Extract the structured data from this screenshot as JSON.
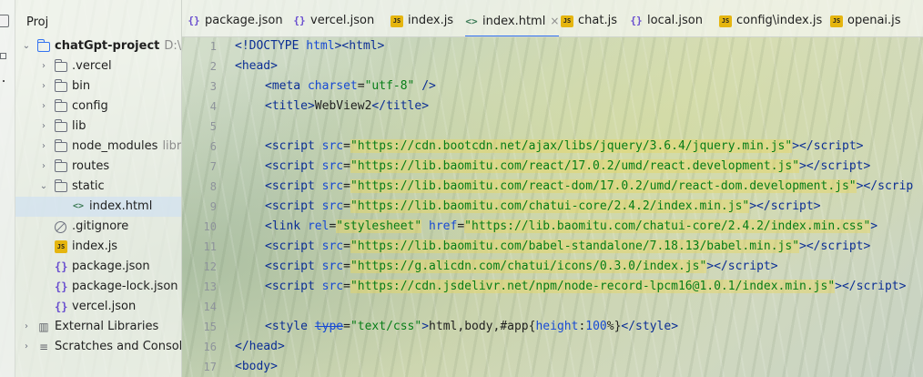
{
  "project_panel": {
    "title": "Proj",
    "tree": [
      {
        "label": "chatGpt-project",
        "hint": "D:\\Pro",
        "type": "module-folder",
        "chevron": "⌄"
      },
      {
        "label": ".vercel",
        "type": "folder",
        "chevron": "›"
      },
      {
        "label": "bin",
        "type": "folder",
        "chevron": "›"
      },
      {
        "label": "config",
        "type": "folder",
        "chevron": "›"
      },
      {
        "label": "lib",
        "type": "folder",
        "chevron": "›"
      },
      {
        "label": "node_modules",
        "hint": "libra",
        "type": "folder",
        "chevron": "›"
      },
      {
        "label": "routes",
        "type": "folder",
        "chevron": "›"
      },
      {
        "label": "static",
        "type": "folder",
        "chevron": "⌄"
      },
      {
        "label": "index.html",
        "type": "html-file",
        "chevron": ""
      },
      {
        "label": ".gitignore",
        "type": "ignore-file",
        "chevron": ""
      },
      {
        "label": "index.js",
        "type": "js-file",
        "chevron": ""
      },
      {
        "label": "package.json",
        "type": "json-file",
        "chevron": ""
      },
      {
        "label": "package-lock.json",
        "type": "json-file",
        "chevron": ""
      },
      {
        "label": "vercel.json",
        "type": "json-file",
        "chevron": ""
      },
      {
        "label": "External Libraries",
        "type": "libraries",
        "chevron": "›"
      },
      {
        "label": "Scratches and Console",
        "type": "scratches",
        "chevron": "›"
      }
    ]
  },
  "tabs": [
    {
      "label": "package.json",
      "icon": "json-icon",
      "glyph": "{}"
    },
    {
      "label": "vercel.json",
      "icon": "json-icon",
      "glyph": "{}"
    },
    {
      "label": "index.js",
      "icon": "js-icon",
      "glyph": "JS"
    },
    {
      "label": "index.html",
      "icon": "html-icon",
      "glyph": "<>",
      "active": true,
      "close": "×"
    },
    {
      "label": "chat.js",
      "icon": "js-icon",
      "glyph": "JS"
    },
    {
      "label": "local.json",
      "icon": "json-icon",
      "glyph": "{}"
    },
    {
      "label": "config\\index.js",
      "icon": "js-icon",
      "glyph": "JS"
    },
    {
      "label": "openai.js",
      "icon": "js-icon",
      "glyph": "JS"
    }
  ],
  "editor": {
    "line_numbers": [
      "1",
      "2",
      "3",
      "4",
      "5",
      "6",
      "7",
      "8",
      "9",
      "10",
      "11",
      "12",
      "13",
      "14",
      "15",
      "16",
      "17"
    ],
    "lines": [
      {
        "indent": 0,
        "tokens": [
          [
            "t",
            "<!DOCTYPE "
          ],
          [
            "a",
            "html"
          ],
          [
            "t",
            ">"
          ],
          [
            "t",
            "<html>"
          ]
        ]
      },
      {
        "indent": 0,
        "tokens": [
          [
            "t",
            "<head>"
          ]
        ]
      },
      {
        "indent": 1,
        "tokens": [
          [
            "t",
            "<meta "
          ],
          [
            "a",
            "charset"
          ],
          [
            "p",
            "="
          ],
          [
            "s",
            "\"utf-8\""
          ],
          [
            "t",
            " />"
          ]
        ]
      },
      {
        "indent": 1,
        "tokens": [
          [
            "t",
            "<title>"
          ],
          [
            "p",
            "WebView2"
          ],
          [
            "t",
            "</title>"
          ]
        ]
      },
      {
        "indent": 0,
        "tokens": []
      },
      {
        "indent": 1,
        "tokens": [
          [
            "t",
            "<script "
          ],
          [
            "a",
            "src"
          ],
          [
            "p",
            "="
          ],
          [
            "sh",
            "\"https://cdn.bootcdn.net/ajax/libs/jquery/3.6.4/jquery.min.js\""
          ],
          [
            "t",
            "></"
          ],
          [
            "t",
            "script"
          ],
          [
            "t",
            ">"
          ]
        ]
      },
      {
        "indent": 1,
        "tokens": [
          [
            "t",
            "<script "
          ],
          [
            "a",
            "src"
          ],
          [
            "p",
            "="
          ],
          [
            "sh",
            "\"https://lib.baomitu.com/react/17.0.2/umd/react.development.js\""
          ],
          [
            "t",
            "></"
          ],
          [
            "t",
            "script"
          ],
          [
            "t",
            ">"
          ]
        ]
      },
      {
        "indent": 1,
        "tokens": [
          [
            "t",
            "<script "
          ],
          [
            "a",
            "src"
          ],
          [
            "p",
            "="
          ],
          [
            "sh",
            "\"https://lib.baomitu.com/react-dom/17.0.2/umd/react-dom.development.js\""
          ],
          [
            "t",
            "></"
          ],
          [
            "t",
            "scrip"
          ]
        ]
      },
      {
        "indent": 1,
        "tokens": [
          [
            "t",
            "<script "
          ],
          [
            "a",
            "src"
          ],
          [
            "p",
            "="
          ],
          [
            "sh",
            "\"https://lib.baomitu.com/chatui-core/2.4.2/index.min.js\""
          ],
          [
            "t",
            "></"
          ],
          [
            "t",
            "script"
          ],
          [
            "t",
            ">"
          ]
        ]
      },
      {
        "indent": 1,
        "tokens": [
          [
            "t",
            "<link "
          ],
          [
            "a",
            "rel"
          ],
          [
            "p",
            "="
          ],
          [
            "sh",
            "\"stylesheet\""
          ],
          [
            "p",
            " "
          ],
          [
            "a",
            "href"
          ],
          [
            "p",
            "="
          ],
          [
            "sh",
            "\"https://lib.baomitu.com/chatui-core/2.4.2/index.min.css\""
          ],
          [
            "t",
            ">"
          ]
        ]
      },
      {
        "indent": 1,
        "tokens": [
          [
            "t",
            "<script "
          ],
          [
            "a",
            "src"
          ],
          [
            "p",
            "="
          ],
          [
            "sh",
            "\"https://lib.baomitu.com/babel-standalone/7.18.13/babel.min.js\""
          ],
          [
            "t",
            "></"
          ],
          [
            "t",
            "script"
          ],
          [
            "t",
            ">"
          ]
        ]
      },
      {
        "indent": 1,
        "tokens": [
          [
            "t",
            "<script "
          ],
          [
            "a",
            "src"
          ],
          [
            "p",
            "="
          ],
          [
            "sh",
            "\"https://g.alicdn.com/chatui/icons/0.3.0/index.js\""
          ],
          [
            "t",
            "></"
          ],
          [
            "t",
            "script"
          ],
          [
            "t",
            ">"
          ]
        ]
      },
      {
        "indent": 1,
        "tokens": [
          [
            "t",
            "<script "
          ],
          [
            "a",
            "src"
          ],
          [
            "p",
            "="
          ],
          [
            "sh",
            "\"https://cdn.jsdelivr.net/npm/node-record-lpcm16@1.0.1/index.min.js\""
          ],
          [
            "t",
            "></"
          ],
          [
            "t",
            "script"
          ],
          [
            "t",
            ">"
          ]
        ]
      },
      {
        "indent": 0,
        "tokens": []
      },
      {
        "indent": 1,
        "tokens": [
          [
            "t",
            "<style "
          ],
          [
            "x",
            "type"
          ],
          [
            "p",
            "="
          ],
          [
            "s",
            "\"text/css\""
          ],
          [
            "t",
            ">"
          ],
          [
            "p",
            "html"
          ],
          [
            "p",
            ","
          ],
          [
            "p",
            "body"
          ],
          [
            "p",
            ","
          ],
          [
            "p",
            "#app"
          ],
          [
            "p",
            "{"
          ],
          [
            "c",
            "height"
          ],
          [
            "p",
            ":"
          ],
          [
            "c",
            "100"
          ],
          [
            "p",
            "%"
          ],
          [
            "p",
            "}"
          ],
          [
            "t",
            "</style>"
          ]
        ]
      },
      {
        "indent": 0,
        "tokens": [
          [
            "t",
            "</head>"
          ]
        ]
      },
      {
        "indent": 0,
        "tokens": [
          [
            "t",
            "<body>"
          ]
        ]
      }
    ]
  }
}
